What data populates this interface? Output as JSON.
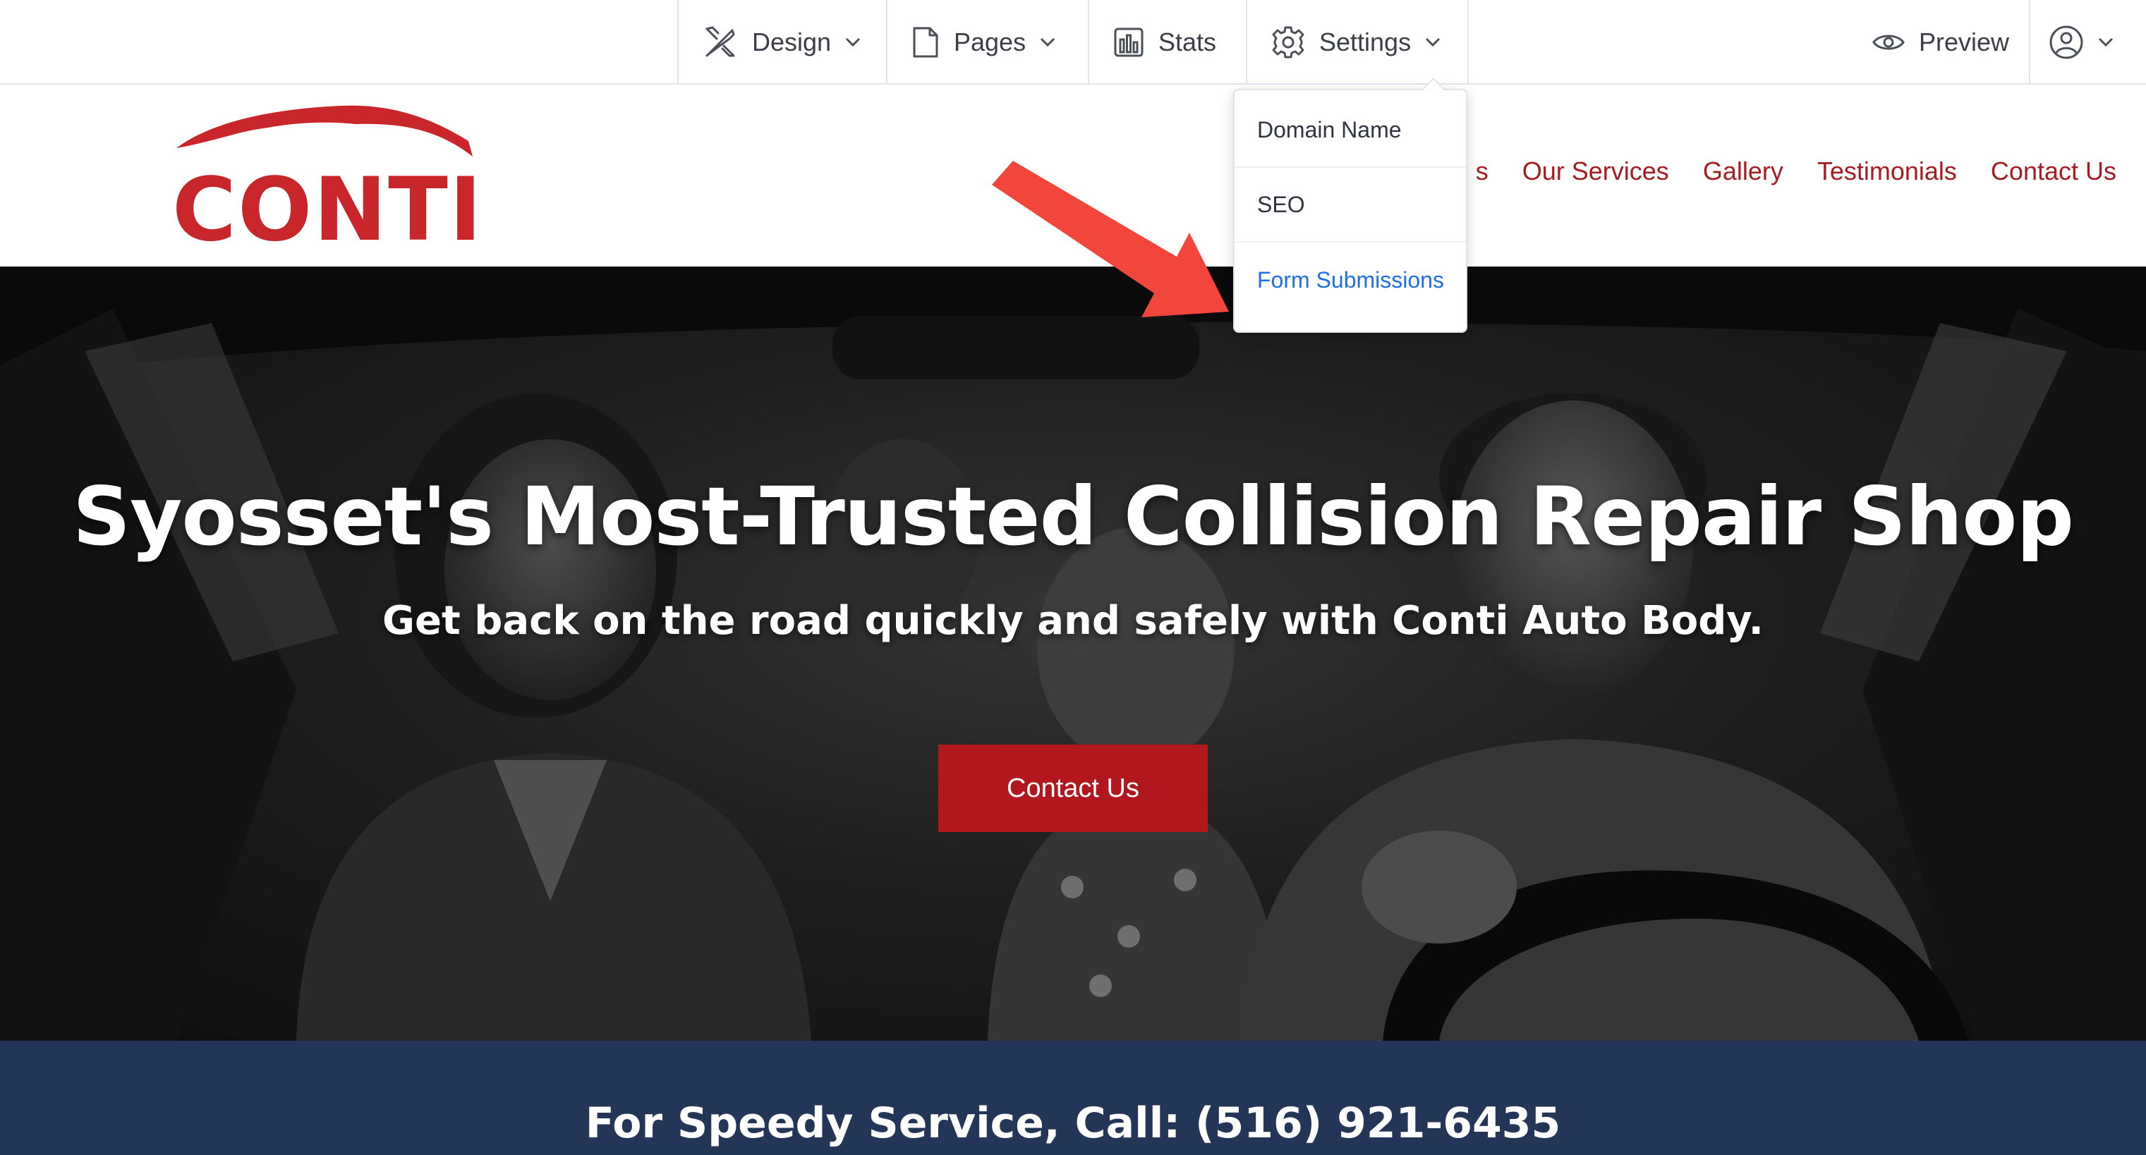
{
  "editor_bar": {
    "design_label": "Design",
    "pages_label": "Pages",
    "stats_label": "Stats",
    "settings_label": "Settings",
    "preview_label": "Preview"
  },
  "settings_menu": {
    "items": [
      {
        "label": "Domain Name"
      },
      {
        "label": "SEO"
      },
      {
        "label": "Form Submissions",
        "highlighted": true
      }
    ]
  },
  "site": {
    "logo_text": "CONTI",
    "nav": [
      "s",
      "Our Services",
      "Gallery",
      "Testimonials",
      "Contact Us"
    ]
  },
  "hero": {
    "title": "Syosset's Most-Trusted Collision Repair Shop",
    "subtitle": "Get back on the road quickly and safely with Conti Auto Body.",
    "cta_label": "Contact Us"
  },
  "call_band": {
    "text": "For Speedy Service, Call: (516) 921-6435"
  },
  "colors": {
    "brand_red": "#c8262b",
    "cta_red": "#b2171e",
    "band_navy": "#233657",
    "link_blue": "#1f6fe5",
    "arrow_red": "#f2463c"
  }
}
